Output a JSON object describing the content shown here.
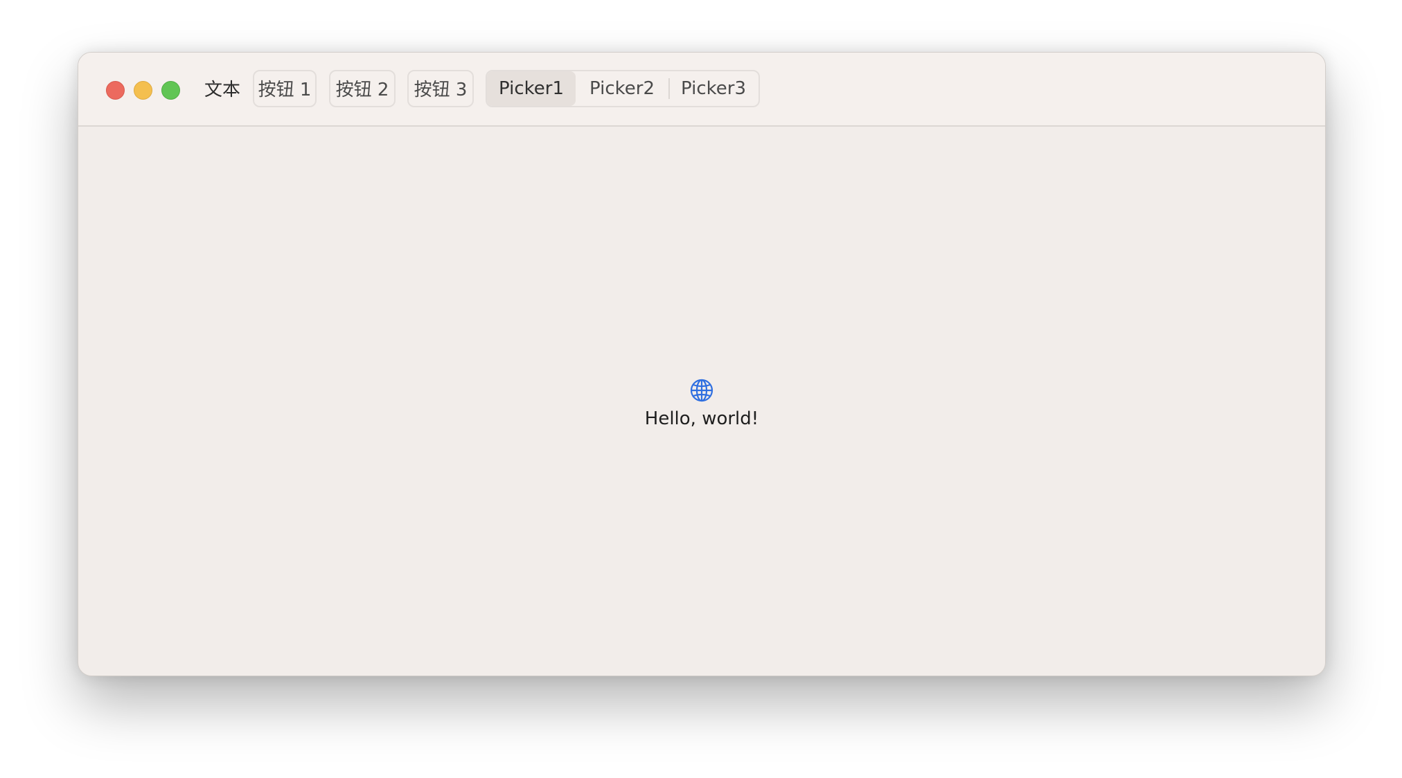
{
  "toolbar": {
    "text_label": "文本",
    "buttons": [
      {
        "label": "按钮 1"
      },
      {
        "label": "按钮 2"
      },
      {
        "label": "按钮 3"
      }
    ],
    "picker": {
      "options": [
        "Picker1",
        "Picker2",
        "Picker3"
      ],
      "selected": "Picker1"
    }
  },
  "content": {
    "icon": "globe-icon",
    "message": "Hello, world!"
  },
  "colors": {
    "accent": "#2f6fe0",
    "close": "#ec6a5e",
    "minimize": "#f4bf4f",
    "maximize": "#61c554"
  }
}
